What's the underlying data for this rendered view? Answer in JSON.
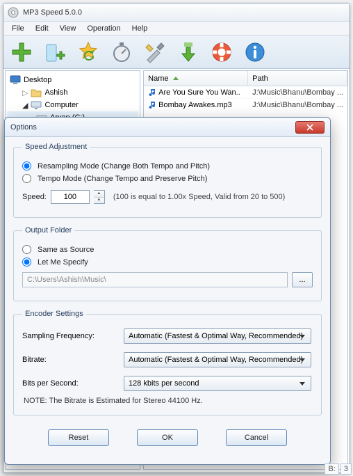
{
  "window": {
    "title": "MP3 Speed 5.0.0"
  },
  "menu": [
    "File",
    "Edit",
    "View",
    "Operation",
    "Help"
  ],
  "tree": {
    "root": "Desktop",
    "items": [
      "Ashish",
      "Computer",
      "Aryan (C:)"
    ]
  },
  "list": {
    "columns": {
      "name": "Name",
      "path": "Path"
    },
    "rows": [
      {
        "name": "Are You Sure You Wan..",
        "path": "J:\\Music\\Bhanu\\Bombay ..."
      },
      {
        "name": "Bombay Awakes.mp3",
        "path": "J:\\Music\\Bhanu\\Bombay ..."
      }
    ]
  },
  "options": {
    "title": "Options",
    "speed_adjustment": {
      "legend": "Speed Adjustment",
      "resampling": "Resampling Mode (Change Both Tempo and Pitch)",
      "tempo": "Tempo Mode (Change Tempo and Preserve Pitch)",
      "speed_label": "Speed:",
      "speed_value": "100",
      "speed_hint": "(100 is equal to 1.00x Speed, Valid from 20 to 500)"
    },
    "output_folder": {
      "legend": "Output Folder",
      "same": "Same as Source",
      "specify": "Let Me Specify",
      "path": "C:\\Users\\Ashish\\Music\\",
      "browse": "..."
    },
    "encoder": {
      "legend": "Encoder Settings",
      "sampling_label": "Sampling Frequency:",
      "sampling_value": "Automatic (Fastest & Optimal Way, Recommended)",
      "bitrate_label": "Bitrate:",
      "bitrate_value": "Automatic (Fastest & Optimal Way, Recommended)",
      "bps_label": "Bits per Second:",
      "bps_value": "128 kbits per second",
      "note": "NOTE: The Bitrate is Estimated  for Stereo 44100 Hz."
    },
    "buttons": {
      "reset": "Reset",
      "ok": "OK",
      "cancel": "Cancel"
    }
  },
  "status": {
    "b": "B:",
    "three": "3"
  }
}
